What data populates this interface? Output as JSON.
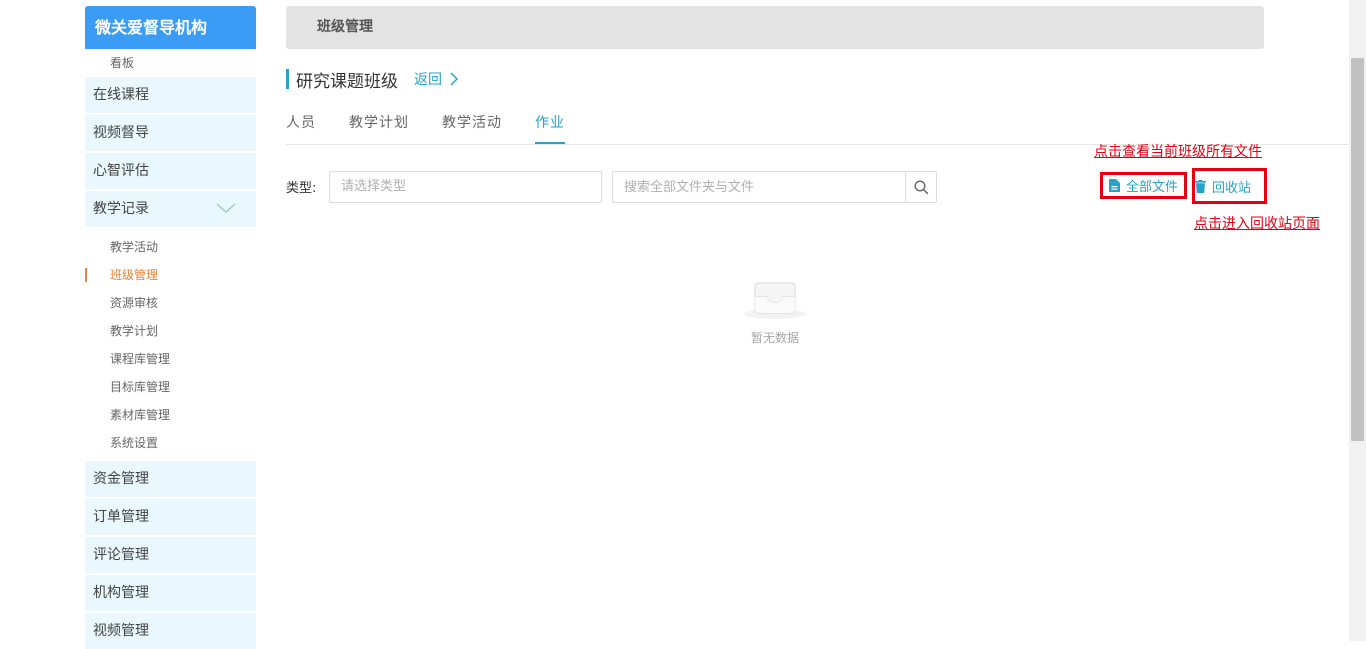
{
  "sidebar": {
    "brand": "微关爱督导机构",
    "board": "看板",
    "items_top": [
      "在线课程",
      "视频督导",
      "心智评估"
    ],
    "teaching_record": "教学记录",
    "sub_items": [
      "教学活动",
      "班级管理",
      "资源审核",
      "教学计划",
      "课程库管理",
      "目标库管理",
      "素材库管理",
      "系统设置"
    ],
    "active_sub_index": 1,
    "items_bottom": [
      "资金管理",
      "订单管理",
      "评论管理",
      "机构管理",
      "视频管理"
    ]
  },
  "header": {
    "title": "班级管理"
  },
  "page": {
    "class_title": "研究课题班级",
    "back_label": "返回"
  },
  "tabs": [
    "人员",
    "教学计划",
    "教学活动",
    "作业"
  ],
  "active_tab": 3,
  "filter": {
    "type_label": "类型:",
    "type_placeholder": "请选择类型",
    "search_placeholder": "搜索全部文件夹与文件"
  },
  "actions": {
    "all_files": "全部文件",
    "recycle_bin": "回收站"
  },
  "annotations": {
    "all_files_note": "点击查看当前班级所有文件",
    "recycle_note": "点击进入回收站页面"
  },
  "empty": {
    "text": "暂无数据"
  },
  "colors": {
    "brand": "#3a9cf5",
    "accent": "#26a3c9",
    "active_sub": "#e8843a",
    "annotation": "#e60012",
    "menu_bg": "#e9f8fc"
  }
}
